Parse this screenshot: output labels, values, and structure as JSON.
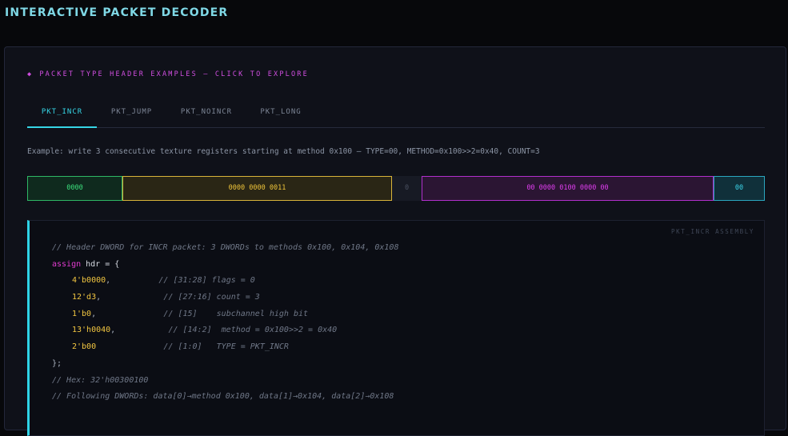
{
  "app_title": "INTERACTIVE PACKET DECODER",
  "section_heading": "PACKET TYPE HEADER EXAMPLES — CLICK TO EXPLORE",
  "tabs": [
    {
      "label": "PKT_INCR",
      "active": true
    },
    {
      "label": "PKT_JUMP",
      "active": false
    },
    {
      "label": "PKT_NOINCR",
      "active": false
    },
    {
      "label": "PKT_LONG",
      "active": false
    }
  ],
  "example_text": "Example: write 3 consecutive texture registers starting at method 0x100 — TYPE=00, METHOD=0x100>>2=0x40, COUNT=3",
  "bitfields": [
    {
      "name": "flags",
      "bits": "0000",
      "color": "#3ce07d"
    },
    {
      "name": "count",
      "bits": "0000 0000 0011",
      "color": "#f0c53a"
    },
    {
      "name": "subchannel",
      "bits": "0",
      "color": "#4a5060"
    },
    {
      "name": "method",
      "bits": "00 0000 0100 0000 00",
      "color": "#e03ef0"
    },
    {
      "name": "type",
      "bits": "00",
      "color": "#3cd6ea"
    }
  ],
  "code": {
    "caption": "PKT_INCR ASSEMBLY",
    "comment_header": "// Header DWORD for INCR packet: 3 DWORDs to methods 0x100, 0x104, 0x108",
    "assign_kw": "assign",
    "assign_rest": " hdr = {",
    "fields": [
      {
        "value": "4'b0000",
        "sep": ",",
        "pad": "          ",
        "comment": "// [31:28] flags = 0"
      },
      {
        "value": "12'd3",
        "sep": ",",
        "pad": "             ",
        "comment": "// [27:16] count = 3"
      },
      {
        "value": "1'b0",
        "sep": ",",
        "pad": "              ",
        "comment": "// [15]    subchannel high bit"
      },
      {
        "value": "13'h0040",
        "sep": ",",
        "pad": "           ",
        "comment": "// [14:2]  method = 0x100>>2 = 0x40"
      },
      {
        "value": "2'b00",
        "sep": "",
        "pad": "              ",
        "comment": "// [1:0]   TYPE = PKT_INCR"
      }
    ],
    "close": "};",
    "comment_hex": "// Hex: 32'h00300100",
    "comment_following": "// Following DWORDs: data[0]→method 0x100, data[1]→0x104, data[2]→0x108"
  }
}
